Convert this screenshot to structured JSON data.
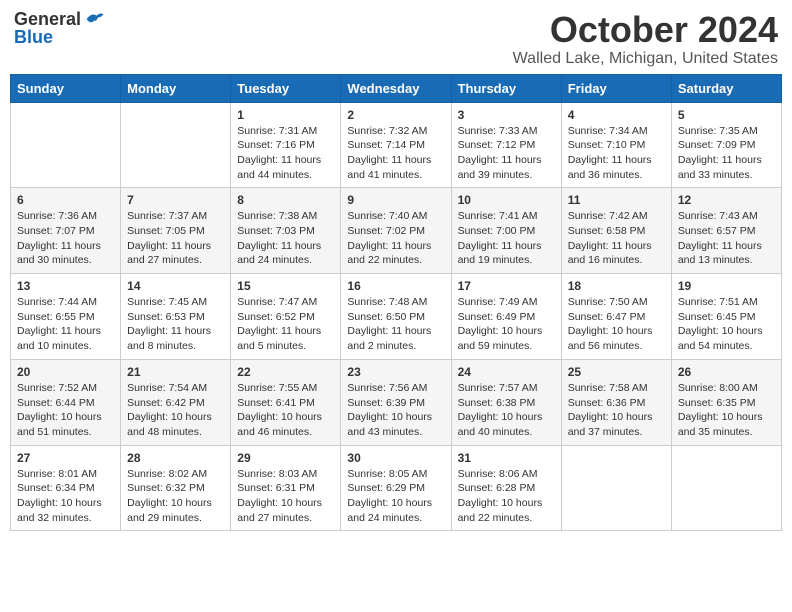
{
  "header": {
    "logo_general": "General",
    "logo_blue": "Blue",
    "month": "October 2024",
    "location": "Walled Lake, Michigan, United States"
  },
  "weekdays": [
    "Sunday",
    "Monday",
    "Tuesday",
    "Wednesday",
    "Thursday",
    "Friday",
    "Saturday"
  ],
  "weeks": [
    [
      {
        "day": null,
        "sunrise": "",
        "sunset": "",
        "daylight": ""
      },
      {
        "day": null,
        "sunrise": "",
        "sunset": "",
        "daylight": ""
      },
      {
        "day": "1",
        "sunrise": "Sunrise: 7:31 AM",
        "sunset": "Sunset: 7:16 PM",
        "daylight": "Daylight: 11 hours and 44 minutes."
      },
      {
        "day": "2",
        "sunrise": "Sunrise: 7:32 AM",
        "sunset": "Sunset: 7:14 PM",
        "daylight": "Daylight: 11 hours and 41 minutes."
      },
      {
        "day": "3",
        "sunrise": "Sunrise: 7:33 AM",
        "sunset": "Sunset: 7:12 PM",
        "daylight": "Daylight: 11 hours and 39 minutes."
      },
      {
        "day": "4",
        "sunrise": "Sunrise: 7:34 AM",
        "sunset": "Sunset: 7:10 PM",
        "daylight": "Daylight: 11 hours and 36 minutes."
      },
      {
        "day": "5",
        "sunrise": "Sunrise: 7:35 AM",
        "sunset": "Sunset: 7:09 PM",
        "daylight": "Daylight: 11 hours and 33 minutes."
      }
    ],
    [
      {
        "day": "6",
        "sunrise": "Sunrise: 7:36 AM",
        "sunset": "Sunset: 7:07 PM",
        "daylight": "Daylight: 11 hours and 30 minutes."
      },
      {
        "day": "7",
        "sunrise": "Sunrise: 7:37 AM",
        "sunset": "Sunset: 7:05 PM",
        "daylight": "Daylight: 11 hours and 27 minutes."
      },
      {
        "day": "8",
        "sunrise": "Sunrise: 7:38 AM",
        "sunset": "Sunset: 7:03 PM",
        "daylight": "Daylight: 11 hours and 24 minutes."
      },
      {
        "day": "9",
        "sunrise": "Sunrise: 7:40 AM",
        "sunset": "Sunset: 7:02 PM",
        "daylight": "Daylight: 11 hours and 22 minutes."
      },
      {
        "day": "10",
        "sunrise": "Sunrise: 7:41 AM",
        "sunset": "Sunset: 7:00 PM",
        "daylight": "Daylight: 11 hours and 19 minutes."
      },
      {
        "day": "11",
        "sunrise": "Sunrise: 7:42 AM",
        "sunset": "Sunset: 6:58 PM",
        "daylight": "Daylight: 11 hours and 16 minutes."
      },
      {
        "day": "12",
        "sunrise": "Sunrise: 7:43 AM",
        "sunset": "Sunset: 6:57 PM",
        "daylight": "Daylight: 11 hours and 13 minutes."
      }
    ],
    [
      {
        "day": "13",
        "sunrise": "Sunrise: 7:44 AM",
        "sunset": "Sunset: 6:55 PM",
        "daylight": "Daylight: 11 hours and 10 minutes."
      },
      {
        "day": "14",
        "sunrise": "Sunrise: 7:45 AM",
        "sunset": "Sunset: 6:53 PM",
        "daylight": "Daylight: 11 hours and 8 minutes."
      },
      {
        "day": "15",
        "sunrise": "Sunrise: 7:47 AM",
        "sunset": "Sunset: 6:52 PM",
        "daylight": "Daylight: 11 hours and 5 minutes."
      },
      {
        "day": "16",
        "sunrise": "Sunrise: 7:48 AM",
        "sunset": "Sunset: 6:50 PM",
        "daylight": "Daylight: 11 hours and 2 minutes."
      },
      {
        "day": "17",
        "sunrise": "Sunrise: 7:49 AM",
        "sunset": "Sunset: 6:49 PM",
        "daylight": "Daylight: 10 hours and 59 minutes."
      },
      {
        "day": "18",
        "sunrise": "Sunrise: 7:50 AM",
        "sunset": "Sunset: 6:47 PM",
        "daylight": "Daylight: 10 hours and 56 minutes."
      },
      {
        "day": "19",
        "sunrise": "Sunrise: 7:51 AM",
        "sunset": "Sunset: 6:45 PM",
        "daylight": "Daylight: 10 hours and 54 minutes."
      }
    ],
    [
      {
        "day": "20",
        "sunrise": "Sunrise: 7:52 AM",
        "sunset": "Sunset: 6:44 PM",
        "daylight": "Daylight: 10 hours and 51 minutes."
      },
      {
        "day": "21",
        "sunrise": "Sunrise: 7:54 AM",
        "sunset": "Sunset: 6:42 PM",
        "daylight": "Daylight: 10 hours and 48 minutes."
      },
      {
        "day": "22",
        "sunrise": "Sunrise: 7:55 AM",
        "sunset": "Sunset: 6:41 PM",
        "daylight": "Daylight: 10 hours and 46 minutes."
      },
      {
        "day": "23",
        "sunrise": "Sunrise: 7:56 AM",
        "sunset": "Sunset: 6:39 PM",
        "daylight": "Daylight: 10 hours and 43 minutes."
      },
      {
        "day": "24",
        "sunrise": "Sunrise: 7:57 AM",
        "sunset": "Sunset: 6:38 PM",
        "daylight": "Daylight: 10 hours and 40 minutes."
      },
      {
        "day": "25",
        "sunrise": "Sunrise: 7:58 AM",
        "sunset": "Sunset: 6:36 PM",
        "daylight": "Daylight: 10 hours and 37 minutes."
      },
      {
        "day": "26",
        "sunrise": "Sunrise: 8:00 AM",
        "sunset": "Sunset: 6:35 PM",
        "daylight": "Daylight: 10 hours and 35 minutes."
      }
    ],
    [
      {
        "day": "27",
        "sunrise": "Sunrise: 8:01 AM",
        "sunset": "Sunset: 6:34 PM",
        "daylight": "Daylight: 10 hours and 32 minutes."
      },
      {
        "day": "28",
        "sunrise": "Sunrise: 8:02 AM",
        "sunset": "Sunset: 6:32 PM",
        "daylight": "Daylight: 10 hours and 29 minutes."
      },
      {
        "day": "29",
        "sunrise": "Sunrise: 8:03 AM",
        "sunset": "Sunset: 6:31 PM",
        "daylight": "Daylight: 10 hours and 27 minutes."
      },
      {
        "day": "30",
        "sunrise": "Sunrise: 8:05 AM",
        "sunset": "Sunset: 6:29 PM",
        "daylight": "Daylight: 10 hours and 24 minutes."
      },
      {
        "day": "31",
        "sunrise": "Sunrise: 8:06 AM",
        "sunset": "Sunset: 6:28 PM",
        "daylight": "Daylight: 10 hours and 22 minutes."
      },
      {
        "day": null,
        "sunrise": "",
        "sunset": "",
        "daylight": ""
      },
      {
        "day": null,
        "sunrise": "",
        "sunset": "",
        "daylight": ""
      }
    ]
  ]
}
